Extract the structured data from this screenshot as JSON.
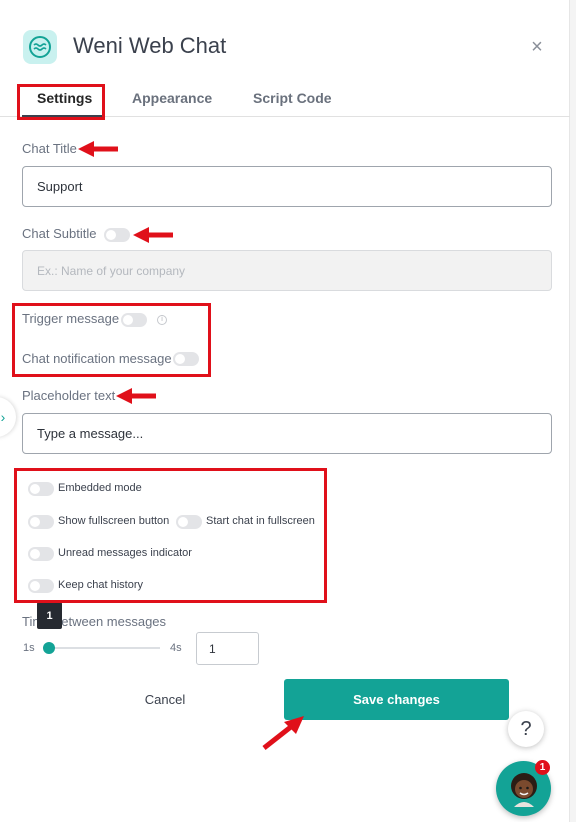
{
  "header": {
    "title": "Weni Web Chat",
    "close_icon": "close-icon",
    "logo_icon": "weni-chat-logo-icon"
  },
  "tabs": [
    {
      "label": "Settings",
      "active": true
    },
    {
      "label": "Appearance",
      "active": false
    },
    {
      "label": "Script Code",
      "active": false
    }
  ],
  "form": {
    "chat_title_label": "Chat Title",
    "chat_title_value": "Support",
    "chat_subtitle_label": "Chat Subtitle",
    "chat_subtitle_placeholder": "Ex.: Name of your company",
    "trigger_message_label": "Trigger message",
    "chat_notification_label": "Chat notification message",
    "placeholder_text_label": "Placeholder text",
    "placeholder_text_value": "Type a message...",
    "options": {
      "embedded_mode": "Embedded mode",
      "show_fullscreen_button": "Show fullscreen button",
      "start_chat_fullscreen": "Start chat in fullscreen",
      "unread_indicator": "Unread messages indicator",
      "keep_history": "Keep chat history"
    },
    "time_between_label": "Time between messages",
    "slider_min": "1s",
    "slider_max": "4s",
    "slider_value": "1",
    "slider_input_value": "1"
  },
  "actions": {
    "cancel": "Cancel",
    "save": "Save changes"
  },
  "floating": {
    "help_icon": "?",
    "badge_count": "1"
  },
  "colors": {
    "accent": "#13a396",
    "annotation": "#e0101a",
    "text": "#3b414d"
  }
}
